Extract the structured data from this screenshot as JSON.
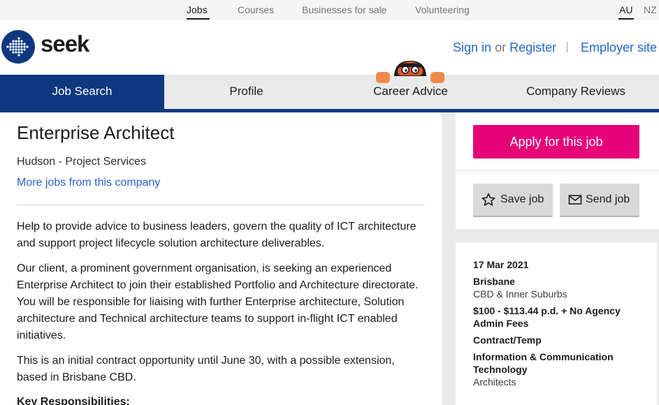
{
  "topnav": {
    "links": [
      "Jobs",
      "Courses",
      "Businesses for sale",
      "Volunteering"
    ],
    "countries": [
      "AU",
      "NZ"
    ]
  },
  "brand": {
    "name": "seek",
    "color": "#0d3880"
  },
  "auth": {
    "sign_in": "Sign in",
    "or": "or",
    "register": "Register",
    "employer": "Employer site"
  },
  "nav": {
    "tabs": [
      "Job Search",
      "Profile",
      "Career Advice",
      "Company Reviews"
    ]
  },
  "job": {
    "title": "Enterprise Architect",
    "company": "Hudson - Project Services",
    "more_jobs": "More jobs from this company",
    "paragraphs": [
      "Help to provide advice to business leaders, govern the quality of ICT architecture and support project lifecycle solution architecture deliverables.",
      "Our client, a prominent government organisation, is seeking an experienced Enterprise Architect to join their established Portfolio and Architecture directorate. You will be responsible for liaising with further Enterprise architecture, Solution architecture and Technical architecture teams to support in-flight ICT enabled initiatives.",
      "This is an initial contract opportunity until June 30, with a possible extension, based in Brisbane CBD."
    ],
    "key_responsibilities": "Key Responsibilities:"
  },
  "actions": {
    "apply": "Apply for this job",
    "save": "Save job",
    "send": "Send job"
  },
  "details": {
    "date": "17 Mar 2021",
    "location": "Brisbane",
    "area": "CBD & Inner Suburbs",
    "salary_line1": "$100 - $113.44 p.d. + No Agency",
    "salary_line2": "Admin Fees",
    "work_type": "Contract/Temp",
    "classification_line1": "Information & Communication",
    "classification_line2": "Technology",
    "subclassification": "Architects"
  },
  "colors": {
    "accent": "#e60278",
    "link": "#2765cf",
    "nav_active": "#0d3880"
  }
}
